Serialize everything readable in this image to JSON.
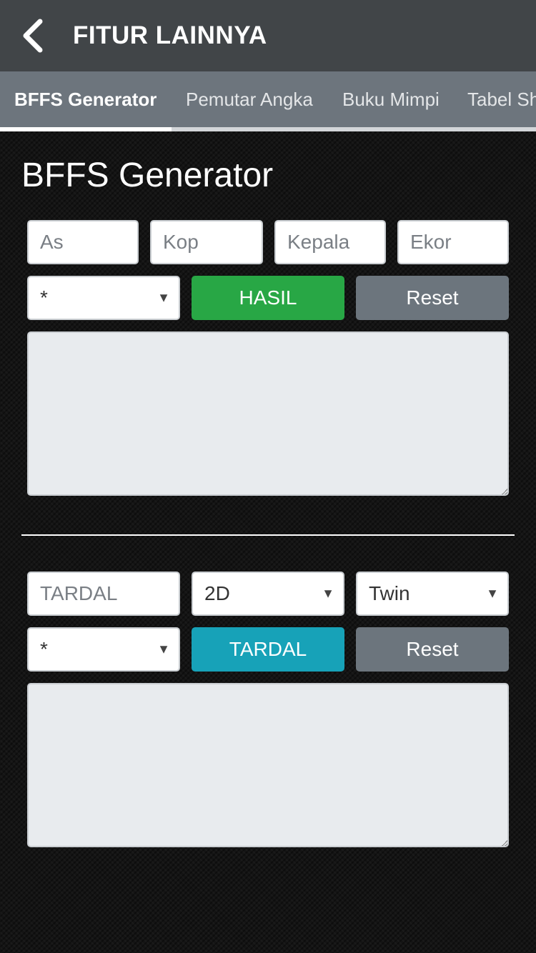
{
  "appbar": {
    "title": "FITUR LAINNYA",
    "back_icon": "chevron-left-icon"
  },
  "tabs": [
    {
      "label": "BFFS Generator",
      "active": true
    },
    {
      "label": "Pemutar Angka",
      "active": false
    },
    {
      "label": "Buku Mimpi",
      "active": false
    },
    {
      "label": "Tabel Sh",
      "active": false
    }
  ],
  "section": {
    "title": "BFFS Generator"
  },
  "bffs": {
    "inputs": [
      {
        "placeholder": "As",
        "value": ""
      },
      {
        "placeholder": "Kop",
        "value": ""
      },
      {
        "placeholder": "Kepala",
        "value": ""
      },
      {
        "placeholder": "Ekor",
        "value": ""
      }
    ],
    "select_value": "*",
    "submit_label": "HASIL",
    "reset_label": "Reset",
    "result": ""
  },
  "tardal": {
    "input": {
      "placeholder": "TARDAL",
      "value": ""
    },
    "select_digit_value": "2D",
    "select_mode_value": "Twin",
    "select_value": "*",
    "submit_label": "TARDAL",
    "reset_label": "Reset",
    "result": ""
  },
  "colors": {
    "appbar": "#414548",
    "tabbar": "#6d757d",
    "hasil_button": "#28a745",
    "tardal_button": "#17a2b8",
    "reset_button": "#6c757d"
  }
}
